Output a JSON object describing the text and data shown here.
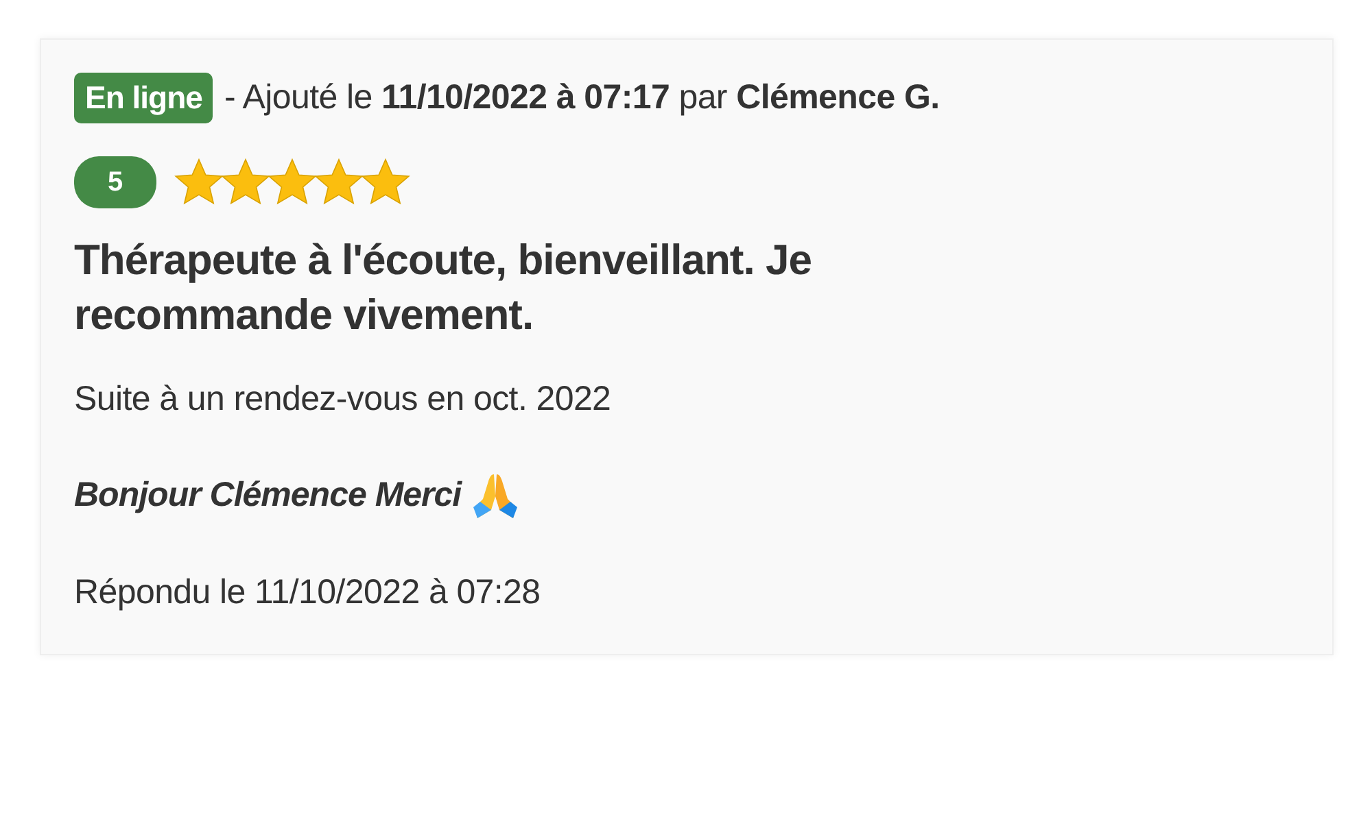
{
  "review": {
    "status_badge": "En ligne",
    "meta": "- Ajouté le **11/10/2022 à 07:17** par **Clémence G.**",
    "rating": "5",
    "stars": 5,
    "title": "Thérapeute à l'écoute, bienveillant. Je recommande vivement.",
    "context": "Suite à un rendez-vous en oct. 2022",
    "reply": "Bonjour Clémence Merci",
    "replied": "Répondu le 11/10/2022 à 07:28"
  }
}
